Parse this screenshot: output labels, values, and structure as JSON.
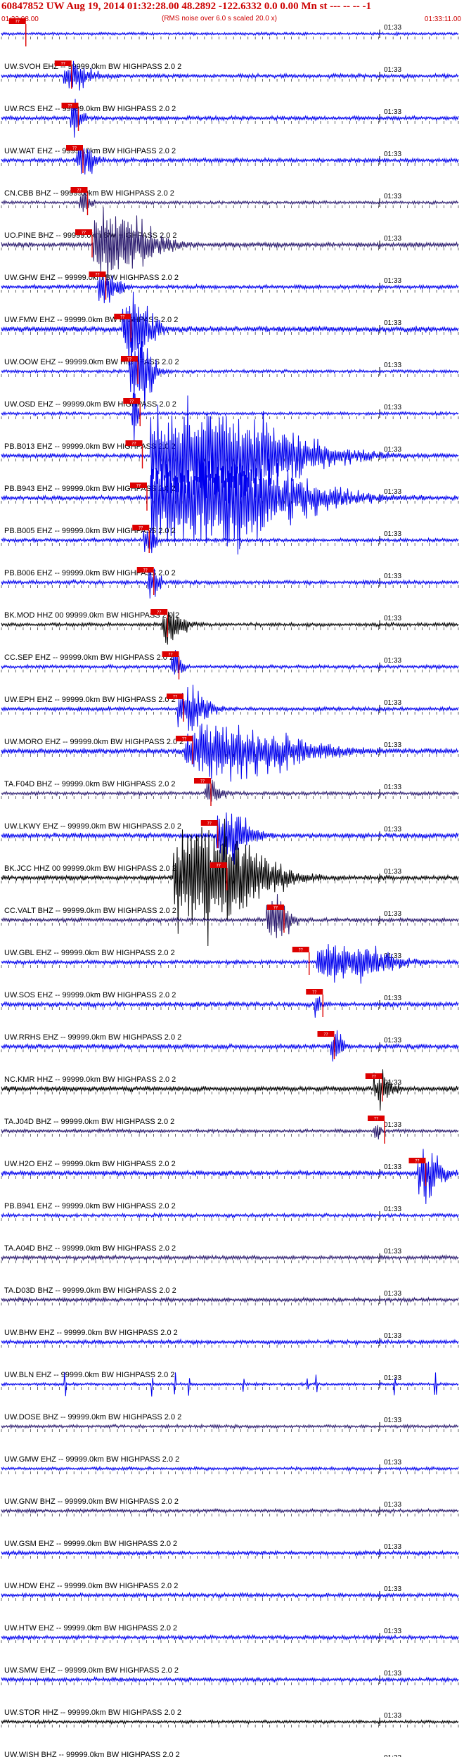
{
  "header": {
    "title": "60847852 UW Aug 19, 2014 01:32:28.00   48.2892 -122.6332  0.0 0.00 Mn st --- -- --  -1",
    "subtitle": "(RMS noise over 6.0 s scaled 20.0 x)",
    "start_time": "01:32:08.00",
    "end_time": "01:33:11.00"
  },
  "colors": {
    "blue_trace": "#0000ee",
    "black_trace": "#000000",
    "purple_trace": "#2a1a6e",
    "pick": "#dd0000",
    "tick": "#000000",
    "header_text": "#cc0000"
  },
  "chart_data": {
    "type": "seismogram",
    "time_range": [
      "01:32:08.00",
      "01:33:11.00"
    ],
    "minute_tick_label": "01:33",
    "pick_label": "??",
    "channels": [
      {
        "station": "",
        "label": "",
        "color": "blue",
        "amp": 0.7,
        "pick": 0.035,
        "burst": null
      },
      {
        "station": "UW.SVOH",
        "label": "UW.SVOH EHZ -- 99999.0km BW  HIGHPASS  2.0  2",
        "color": "blue",
        "amp": 1.0,
        "pick": 0.135,
        "burst": [
          0.16,
          0.05,
          1.6
        ]
      },
      {
        "station": "UW.RCS",
        "label": "UW.RCS EHZ -- 99999.0km BW  HIGHPASS  2.0  2",
        "color": "blue",
        "amp": 1.0,
        "pick": 0.15,
        "burst": [
          0.16,
          0.02,
          2.5
        ]
      },
      {
        "station": "UW.WAT",
        "label": "UW.WAT EHZ -- 99999.0km BW  HIGHPASS  2.0  2",
        "color": "blue",
        "amp": 1.1,
        "pick": 0.16,
        "burst": [
          0.18,
          0.03,
          2.0
        ]
      },
      {
        "station": "CN.CBB",
        "label": "CN.CBB BHZ -- 99999.0km BW  HIGHPASS  2.0  2",
        "color": "purple",
        "amp": 0.8,
        "pick": 0.17,
        "burst": [
          0.18,
          0.02,
          2.0
        ]
      },
      {
        "station": "UO.PINE",
        "label": "UO.PINE BHZ -- 99999.0km BW  HIGHPASS  2.0  2",
        "color": "purple",
        "amp": 1.2,
        "pick": 0.18,
        "burst": [
          0.25,
          0.1,
          4.0
        ]
      },
      {
        "station": "UW.GHW",
        "label": "UW.GHW EHZ -- 99999.0km BW  HIGHPASS  2.0  2",
        "color": "blue",
        "amp": 1.0,
        "pick": 0.21,
        "burst": [
          0.23,
          0.04,
          2.0
        ]
      },
      {
        "station": "UW.FMW",
        "label": "UW.FMW EHZ -- 99999.0km BW  HIGHPASS  2.0  2",
        "color": "blue",
        "amp": 1.4,
        "pick": 0.265,
        "burst": [
          0.29,
          0.05,
          3.0
        ]
      },
      {
        "station": "UW.OOW",
        "label": "UW.OOW EHZ -- 99999.0km BW  HIGHPASS  2.0  2",
        "color": "blue",
        "amp": 0.8,
        "pick": 0.28,
        "burst": [
          0.3,
          0.04,
          6.0
        ]
      },
      {
        "station": "UW.OSD",
        "label": "UW.OSD EHZ -- 99999.0km BW  HIGHPASS  2.0  2",
        "color": "blue",
        "amp": 0.8,
        "pick": 0.285,
        "burst": [
          0.29,
          0.01,
          6.0
        ]
      },
      {
        "station": "PB.B013",
        "label": "PB.B013 EHZ -- 99999.0km BW  HIGHPASS  2.0  2",
        "color": "blue",
        "amp": 1.1,
        "pick": 0.29,
        "burst": [
          0.45,
          0.25,
          6.0
        ]
      },
      {
        "station": "PB.B943",
        "label": "PB.B943 EHZ -- 99999.0km BW  HIGHPASS  2.0  2",
        "color": "blue",
        "amp": 1.1,
        "pick": 0.3,
        "burst": [
          0.45,
          0.25,
          6.0
        ]
      },
      {
        "station": "PB.B005",
        "label": "PB.B005 EHZ -- 99999.0km BW  HIGHPASS  2.0  2",
        "color": "blue",
        "amp": 0.9,
        "pick": 0.305,
        "burst": [
          0.32,
          0.02,
          2.5
        ]
      },
      {
        "station": "PB.B006",
        "label": "PB.B006 EHZ -- 99999.0km BW  HIGHPASS  2.0  2",
        "color": "blue",
        "amp": 1.0,
        "pick": 0.315,
        "burst": [
          0.33,
          0.02,
          2.0
        ]
      },
      {
        "station": "BK.MOD",
        "label": "BK.MOD HHZ 00 99999.0km BW  HIGHPASS  2.0  2",
        "color": "black",
        "amp": 0.9,
        "pick": 0.345,
        "burst": [
          0.37,
          0.04,
          2.5
        ]
      },
      {
        "station": "CC.SEP",
        "label": "CC.SEP EHZ -- 99999.0km BW  HIGHPASS  2.0  2",
        "color": "blue",
        "amp": 0.9,
        "pick": 0.37,
        "burst": [
          0.38,
          0.02,
          2.0
        ]
      },
      {
        "station": "UW.EPH",
        "label": "UW.EPH EHZ -- 99999.0km BW  HIGHPASS  2.0  2",
        "color": "blue",
        "amp": 1.0,
        "pick": 0.38,
        "burst": [
          0.41,
          0.05,
          3.0
        ]
      },
      {
        "station": "UW.MORO",
        "label": "UW.MORO EHZ -- 99999.0km BW  HIGHPASS  2.0  2",
        "color": "blue",
        "amp": 1.3,
        "pick": 0.4,
        "burst": [
          0.5,
          0.2,
          2.5
        ]
      },
      {
        "station": "TA.F04D",
        "label": "TA.F04D BHZ -- 99999.0km BW  HIGHPASS  2.0  2",
        "color": "purple",
        "amp": 0.9,
        "pick": 0.44,
        "burst": [
          0.46,
          0.03,
          1.5
        ]
      },
      {
        "station": "UW.LKWY",
        "label": "UW.LKWY EHZ -- 99999.0km BW  HIGHPASS  2.0  2",
        "color": "blue",
        "amp": 1.3,
        "pick": 0.455,
        "burst": [
          0.5,
          0.06,
          2.5
        ]
      },
      {
        "station": "BK.JCC",
        "label": "BK.JCC HHZ 00 99999.0km BW  HIGHPASS  2.0  2",
        "color": "black",
        "amp": 1.2,
        "pick": 0.475,
        "burst": [
          0.45,
          0.15,
          6.0
        ]
      },
      {
        "station": "CC.VALT",
        "label": "CC.VALT BHZ -- 99999.0km BW  HIGHPASS  2.0  2",
        "color": "purple",
        "amp": 1.0,
        "pick": 0.6,
        "burst": [
          0.6,
          0.04,
          3.0
        ]
      },
      {
        "station": "UW.GBL",
        "label": "UW.GBL EHZ -- 99999.0km BW  HIGHPASS  2.0  2",
        "color": "blue",
        "amp": 1.0,
        "pick": 0.655,
        "burst": [
          0.75,
          0.12,
          2.5
        ]
      },
      {
        "station": "UW.SOS",
        "label": "UW.SOS EHZ -- 99999.0km BW  HIGHPASS  2.0  2",
        "color": "blue",
        "amp": 1.2,
        "pick": 0.685,
        "burst": [
          0.69,
          0.01,
          1.5
        ]
      },
      {
        "station": "UW.RRHS",
        "label": "UW.RRHS EHZ -- 99999.0km BW  HIGHPASS  2.0  2",
        "color": "blue",
        "amp": 1.2,
        "pick": 0.71,
        "burst": [
          0.73,
          0.02,
          1.8
        ]
      },
      {
        "station": "NC.KMR",
        "label": "NC.KMR HHZ -- 99999.0km BW  HIGHPASS  2.0  2",
        "color": "black",
        "amp": 1.3,
        "pick": 0.815,
        "burst": [
          0.83,
          0.03,
          1.8
        ]
      },
      {
        "station": "TA.J04D",
        "label": "TA.J04D BHZ -- 99999.0km BW  HIGHPASS  2.0  2",
        "color": "purple",
        "amp": 0.9,
        "pick": 0.82,
        "burst": [
          0.82,
          0.01,
          1.5
        ]
      },
      {
        "station": "UW.H2O",
        "label": "UW.H2O EHZ -- 99999.0km BW  HIGHPASS  2.0  2",
        "color": "blue",
        "amp": 1.2,
        "pick": 0.91,
        "burst": [
          0.93,
          0.04,
          2.8
        ]
      },
      {
        "station": "PB.B941",
        "label": "PB.B941 EHZ -- 99999.0km BW  HIGHPASS  2.0  2",
        "color": "blue",
        "amp": 0.9,
        "pick": null,
        "burst": null
      },
      {
        "station": "TA.A04D",
        "label": "TA.A04D BHZ -- 99999.0km BW  HIGHPASS  2.0  2",
        "color": "purple",
        "amp": 1.0,
        "pick": null,
        "burst": null
      },
      {
        "station": "TA.D03D",
        "label": "TA.D03D BHZ -- 99999.0km BW  HIGHPASS  2.0  2",
        "color": "purple",
        "amp": 1.0,
        "pick": null,
        "burst": null
      },
      {
        "station": "UW.BHW",
        "label": "UW.BHW EHZ -- 99999.0km BW  HIGHPASS  2.0  2",
        "color": "blue",
        "amp": 1.0,
        "pick": null,
        "burst": null
      },
      {
        "station": "UW.BLN",
        "label": "UW.BLN EHZ -- 99999.0km BW  HIGHPASS  2.0  2",
        "color": "blue",
        "amp": 0.7,
        "pick": null,
        "burst": null,
        "spikes": [
          0.14,
          0.33,
          0.38,
          0.41,
          0.53,
          0.67,
          0.69,
          0.86,
          0.95
        ]
      },
      {
        "station": "UW.DOSE",
        "label": "UW.DOSE BHZ -- 99999.0km BW  HIGHPASS  2.0  2",
        "color": "purple",
        "amp": 0.8,
        "pick": null,
        "burst": null
      },
      {
        "station": "UW.GMW",
        "label": "UW.GMW EHZ -- 99999.0km BW  HIGHPASS  2.0  2",
        "color": "blue",
        "amp": 0.8,
        "pick": null,
        "burst": null
      },
      {
        "station": "UW.GNW",
        "label": "UW.GNW BHZ -- 99999.0km BW  HIGHPASS  2.0  2",
        "color": "purple",
        "amp": 0.9,
        "pick": null,
        "burst": null
      },
      {
        "station": "UW.GSM",
        "label": "UW.GSM EHZ -- 99999.0km BW  HIGHPASS  2.0  2",
        "color": "blue",
        "amp": 1.0,
        "pick": null,
        "burst": null
      },
      {
        "station": "UW.HDW",
        "label": "UW.HDW EHZ -- 99999.0km BW  HIGHPASS  2.0  2",
        "color": "blue",
        "amp": 1.0,
        "pick": null,
        "burst": null
      },
      {
        "station": "UW.HTW",
        "label": "UW.HTW EHZ -- 99999.0km BW  HIGHPASS  2.0  2",
        "color": "blue",
        "amp": 1.0,
        "pick": null,
        "burst": null
      },
      {
        "station": "UW.SMW",
        "label": "UW.SMW EHZ -- 99999.0km BW  HIGHPASS  2.0  2",
        "color": "blue",
        "amp": 1.0,
        "pick": null,
        "burst": null
      },
      {
        "station": "UW.STOR",
        "label": "UW.STOR HHZ -- 99999.0km BW  HIGHPASS  2.0  2",
        "color": "black",
        "amp": 0.8,
        "pick": null,
        "burst": null
      },
      {
        "station": "UW.WISH",
        "label": "UW.WISH BHZ -- 99999.0km BW  HIGHPASS  2.0  2",
        "color": "purple",
        "amp": 0.9,
        "pick": null,
        "burst": null
      }
    ]
  }
}
